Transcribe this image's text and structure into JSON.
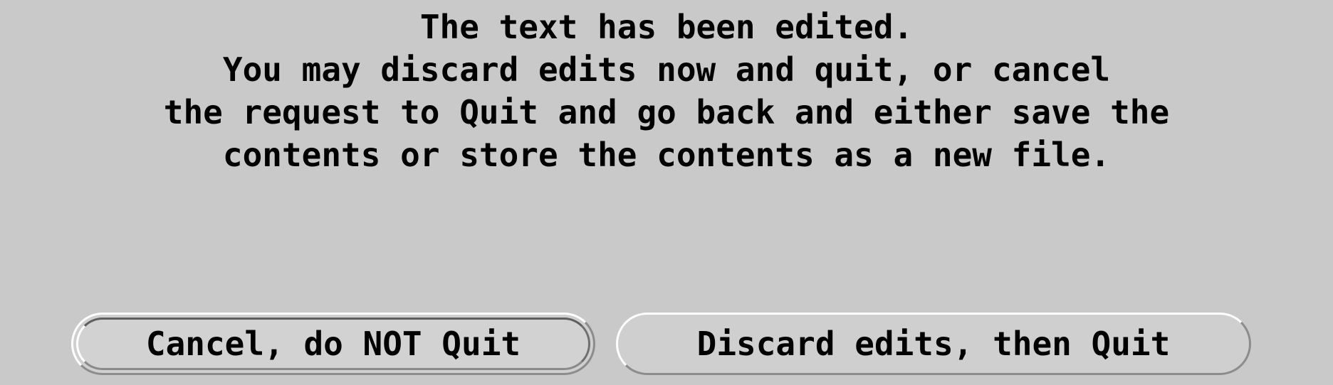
{
  "dialog": {
    "kind": "quit-confirmation",
    "background_color": "#c9c9c9",
    "text_color": "#000000",
    "message": {
      "line1": "The text has been edited.",
      "line2": "You may discard edits now and quit, or cancel",
      "line3": "the request to Quit and go back and either save the",
      "line4": "contents or store the contents as a new file."
    },
    "buttons": {
      "cancel": {
        "label": "Cancel, do NOT Quit",
        "is_default": "true",
        "face_color": "#d2d2d2"
      },
      "discard": {
        "label": "Discard edits, then Quit",
        "is_default": "false",
        "face_color": "#cfcfcf"
      }
    }
  }
}
